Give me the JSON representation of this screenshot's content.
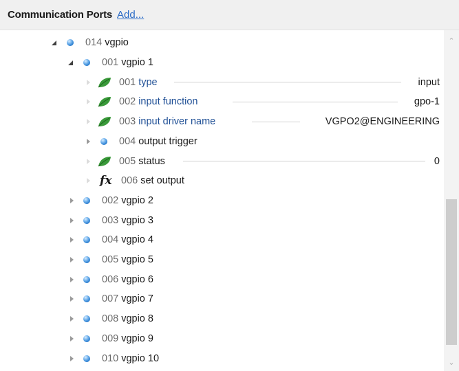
{
  "header": {
    "title": "Communication Ports",
    "add_link": "Add..."
  },
  "tree": {
    "root": {
      "num": "014",
      "name": "vgpio"
    },
    "group": {
      "num": "001",
      "name": "vgpio 1"
    },
    "children": [
      {
        "num": "001",
        "name": "type",
        "value": "input",
        "icon": "leaf-icon"
      },
      {
        "num": "002",
        "name": "input function",
        "value": "gpo-1",
        "icon": "leaf-icon"
      },
      {
        "num": "003",
        "name": "input driver name",
        "value": "VGPO2@ENGINEERING",
        "icon": "leaf-icon"
      },
      {
        "num": "004",
        "name": "output trigger",
        "icon": "ball-icon"
      },
      {
        "num": "005",
        "name": "status",
        "value": "0",
        "icon": "leaf-icon"
      },
      {
        "num": "006",
        "name": "set output",
        "icon": "fx-icon"
      }
    ],
    "siblings": [
      {
        "num": "002",
        "name": "vgpio 2"
      },
      {
        "num": "003",
        "name": "vgpio 3"
      },
      {
        "num": "004",
        "name": "vgpio 4"
      },
      {
        "num": "005",
        "name": "vgpio 5"
      },
      {
        "num": "006",
        "name": "vgpio 6"
      },
      {
        "num": "007",
        "name": "vgpio 7"
      },
      {
        "num": "008",
        "name": "vgpio 8"
      },
      {
        "num": "009",
        "name": "vgpio 9"
      },
      {
        "num": "010",
        "name": "vgpio 10"
      }
    ]
  },
  "colors": {
    "accent": "#2a6bc7",
    "property": "#1f4f95",
    "leaf": "#3a9a3a",
    "ball": "#2b7fd1"
  },
  "icons": {
    "fx": "fx"
  }
}
